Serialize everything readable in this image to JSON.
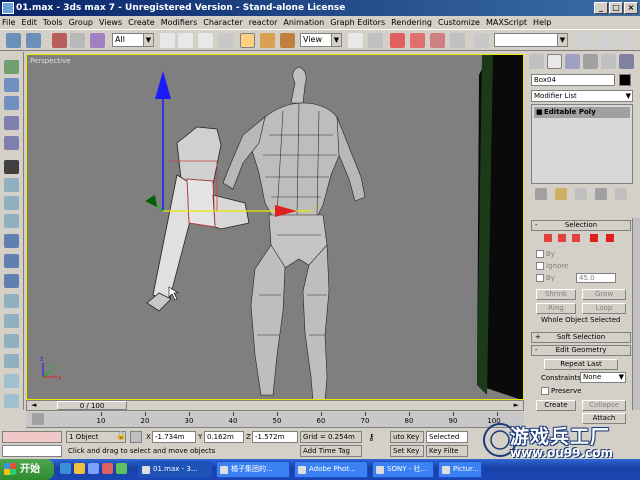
{
  "window": {
    "title": "01.max - 3ds max 7 - Unregistered Version - Stand-alone License",
    "minimize_icon": "minimize-icon",
    "maximize_icon": "maximize-icon",
    "close_icon": "close-icon"
  },
  "menu": [
    "File",
    "Edit",
    "Tools",
    "Group",
    "Views",
    "Create",
    "Modifiers",
    "Character",
    "reactor",
    "Animation",
    "Graph Editors",
    "Rendering",
    "Customize",
    "MAXScript",
    "Help"
  ],
  "toolbar": {
    "selection_filter": "All",
    "reference_coord": "View",
    "named_selection": ""
  },
  "viewport": {
    "label": "Perspective",
    "axis_labels": {
      "x": "x",
      "y": "y",
      "z": "z"
    },
    "colors": {
      "background": "#7f7f7f",
      "active_border": "#e8e800"
    }
  },
  "command_panel": {
    "object_name": "Box04",
    "object_color": "#000000",
    "modifier_list": "Modifier List",
    "stack_item": "Editable Poly",
    "rollouts": {
      "selection": "Selection",
      "soft_selection": "Soft Selection",
      "edit_geometry": "Edit Geometry"
    },
    "selection": {
      "by_vertex": "By",
      "ignore_backfacing": "Ignore",
      "by_angle": "By",
      "angle_value": "45.0",
      "shrink": "Shrink",
      "grow": "Grow",
      "ring": "Ring",
      "loop": "Loop",
      "status": "Whole Object Selected"
    },
    "edit_geometry": {
      "repeat_last": "Repeat Last",
      "constraints_label": "Constraints",
      "constraints_value": "None",
      "preserve": "Preserve",
      "create": "Create",
      "collapse": "Collapse",
      "attach": "Attach"
    }
  },
  "timeline": {
    "slider_label": "0 / 100",
    "ticks": [
      "10",
      "20",
      "30",
      "40",
      "50",
      "60",
      "70",
      "80",
      "90",
      "100"
    ]
  },
  "status": {
    "selection_count": "1 Object",
    "x_label": "X",
    "x_value": "-1.734m",
    "y_label": "Y",
    "y_value": "0.162m",
    "z_label": "Z",
    "z_value": "-1.572m",
    "grid": "Grid = 0.254m",
    "auto_key": "uto Key",
    "selected": "Selected",
    "set_key": "Set Key",
    "key_filter": "Key Filte",
    "prompt": "Click and drag to select and move objects",
    "add_time_tag": "Add Time Tag"
  },
  "taskbar": {
    "start": "开始",
    "items": [
      "01.max - 3...",
      "橘子集团的...",
      "Adobe Phot...",
      "SONY - 社...",
      "Pictur..."
    ]
  },
  "watermark": {
    "text": "游戏兵工厂",
    "url": "www.ou99.com"
  }
}
